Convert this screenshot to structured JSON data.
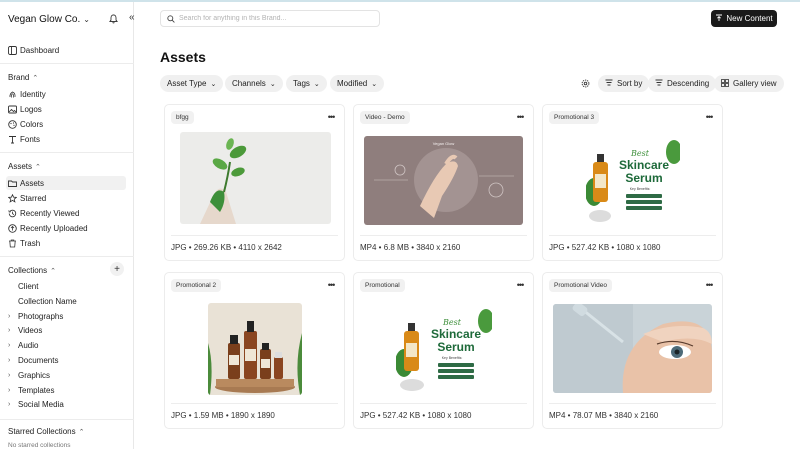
{
  "sidebar": {
    "brand_name": "Vegan Glow Co.",
    "dashboard_label": "Dashboard",
    "brand_section": "Brand",
    "brand_items": [
      {
        "label": "Identity",
        "icon": "fingerprint-icon"
      },
      {
        "label": "Logos",
        "icon": "image-icon"
      },
      {
        "label": "Colors",
        "icon": "palette-icon"
      },
      {
        "label": "Fonts",
        "icon": "type-icon"
      }
    ],
    "assets_section": "Assets",
    "asset_items": [
      {
        "label": "Assets",
        "icon": "folder-icon"
      },
      {
        "label": "Starred",
        "icon": "star-icon"
      },
      {
        "label": "Recently Viewed",
        "icon": "history-icon"
      },
      {
        "label": "Recently Uploaded",
        "icon": "upload-icon"
      },
      {
        "label": "Trash",
        "icon": "trash-icon"
      }
    ],
    "collections_section": "Collections",
    "collection_items": [
      "Client",
      "Collection Name",
      "Photographs",
      "Videos",
      "Audio",
      "Documents",
      "Graphics",
      "Templates",
      "Social Media"
    ],
    "starred_section": "Starred Collections",
    "starred_empty": "No starred collections"
  },
  "header": {
    "search_placeholder": "Search for anything in this Brand...",
    "new_content_label": "New Content"
  },
  "main": {
    "title": "Assets",
    "filters": [
      "Asset Type",
      "Channels",
      "Tags",
      "Modified"
    ],
    "sort_label": "Sort by",
    "order_label": "Descending",
    "view_label": "Gallery view"
  },
  "cards": [
    {
      "tag": "bfgg",
      "meta": "JPG • 269.26 KB • 4110 x 2642"
    },
    {
      "tag": "Video - Demo",
      "meta": "MP4 • 6.8 MB • 3840 x 2160",
      "thumb_text": "Vegan Glow"
    },
    {
      "tag": "Promotional 3",
      "meta": "JPG • 527.42 KB • 1080 x 1080",
      "thumb_title": "Best",
      "thumb_big": "Skincare",
      "thumb_big2": "Serum",
      "thumb_sub": "Key Benefits:"
    },
    {
      "tag": "Promotional 2",
      "meta": "JPG • 1.59 MB • 1890 x 1890"
    },
    {
      "tag": "Promotional",
      "meta": "JPG • 527.42 KB • 1080 x 1080",
      "thumb_title": "Best",
      "thumb_big": "Skincare",
      "thumb_big2": "Serum",
      "thumb_sub": "Key Benefits:"
    },
    {
      "tag": "Promotional Video",
      "meta": "MP4 • 78.07 MB • 3840 x 2160"
    }
  ],
  "colors": {
    "accent_dark": "#1a1a1a",
    "chip_bg": "#f0f0f0"
  }
}
